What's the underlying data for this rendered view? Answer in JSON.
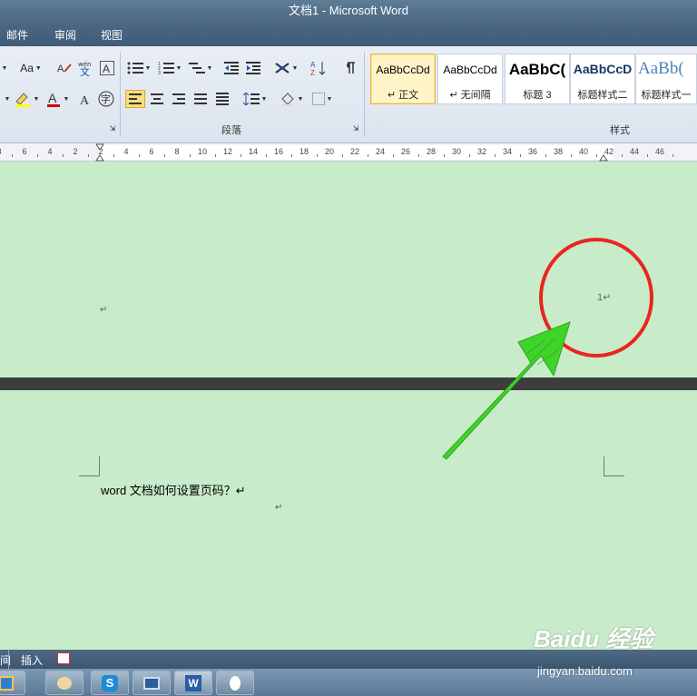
{
  "window": {
    "title": "文档1 - Microsoft Word"
  },
  "menu": {
    "items": [
      "邮件",
      "审阅",
      "视图"
    ]
  },
  "ribbon": {
    "font_group": {
      "change_case_label": "Aa",
      "font_color": "#d40000"
    },
    "paragraph_group": {
      "label": "段落"
    },
    "styles_group": {
      "label": "样式",
      "styles": [
        {
          "sample": "AaBbCcDd",
          "name": "↵ 正文",
          "selected": true
        },
        {
          "sample": "AaBbCcDd",
          "name": "↵ 无间隔"
        },
        {
          "sample": "AaBbC(",
          "name": "标题 3"
        },
        {
          "sample": "AaBbCcD",
          "name": "标题样式二"
        },
        {
          "sample": "AaBb(",
          "name": "标题样式一"
        }
      ]
    }
  },
  "ruler": {
    "labels": [
      "8",
      "6",
      "4",
      "2",
      "2",
      "4",
      "6",
      "8",
      "10",
      "12",
      "14",
      "16",
      "18",
      "20",
      "22",
      "24",
      "26",
      "28",
      "30",
      "32",
      "34",
      "36",
      "38",
      "40",
      "42",
      "44",
      "46"
    ]
  },
  "document": {
    "header_paragraph_mark": "↵",
    "page_number": "1↵",
    "body_text": "word 文档如何设置页码？↵",
    "body_paragraph_mark": "↵"
  },
  "annotation": {
    "circle_color": "#e8261f",
    "arrow_color": "#3fd42a"
  },
  "status_bar": {
    "left_text": "间",
    "insert_label": "插入"
  },
  "taskbar": {
    "buttons": [
      "explorer-icon",
      "paint-icon",
      "app-s-icon",
      "window-icon",
      "word-icon",
      "blank-icon"
    ]
  },
  "watermark": {
    "logo": "Baidu 经验",
    "url": "jingyan.baidu.com"
  }
}
